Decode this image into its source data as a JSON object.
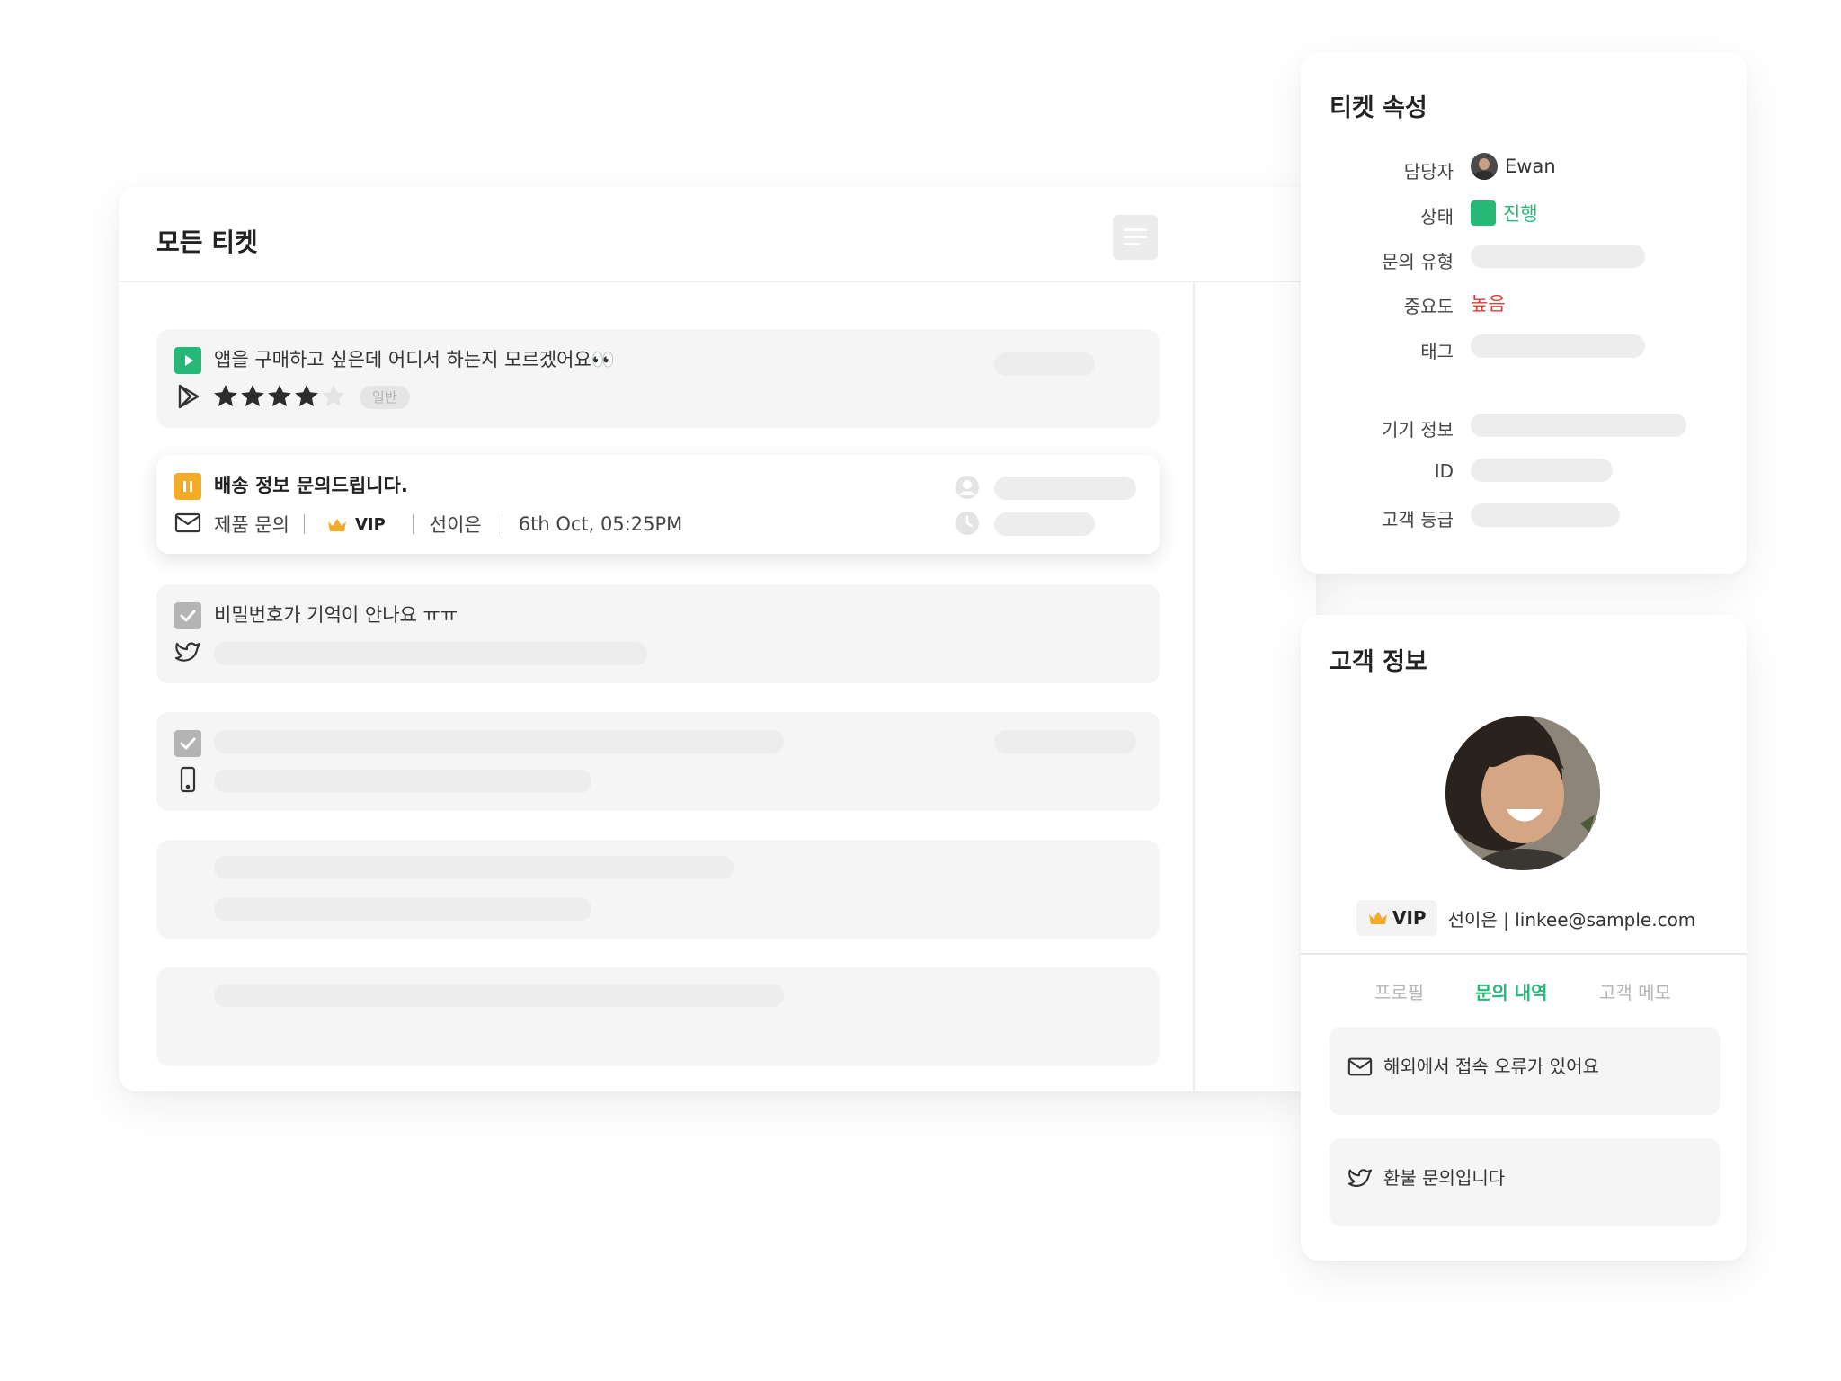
{
  "main": {
    "title": "모든 티켓",
    "tickets": [
      {
        "title": "앱을 구매하고 싶은데 어디서 하는지 모르겠어요👀",
        "status": "play",
        "channel": "google-play",
        "rating": 4,
        "rating_max": 5,
        "tag": "일반"
      },
      {
        "title": "배송 정보 문의드립니다.",
        "status": "pause",
        "channel": "email",
        "type": "제품 문의",
        "tier": "VIP",
        "customer": "선이은",
        "time": "6th Oct, 05:25PM"
      },
      {
        "title": "비밀번호가 기억이 안나요 ㅠㅠ",
        "status": "done",
        "channel": "twitter"
      },
      {
        "title": "",
        "status": "done",
        "channel": "mobile"
      }
    ]
  },
  "attrs": {
    "title": "티켓 속성",
    "assignee_label": "담당자",
    "assignee": "Ewan",
    "status_label": "상태",
    "status": "진행",
    "type_label": "문의 유형",
    "priority_label": "중요도",
    "priority": "높음",
    "tag_label": "태그",
    "device_label": "기기 정보",
    "id_label": "ID",
    "grade_label": "고객 등급"
  },
  "customer": {
    "title": "고객 정보",
    "tier": "VIP",
    "name_email": "선이은 | linkee@sample.com",
    "tabs": [
      "프로필",
      "문의 내역",
      "고객 메모"
    ],
    "active_tab": 1,
    "inquiries": [
      {
        "icon": "mail-icon",
        "title": "해외에서 접속 오류가 있어요"
      },
      {
        "icon": "twitter-icon",
        "title": "환불 문의입니다"
      }
    ]
  },
  "colors": {
    "accent": "#26b877",
    "warning": "#f4ab27",
    "danger": "#e03c31",
    "done": "#b4b4b4"
  }
}
